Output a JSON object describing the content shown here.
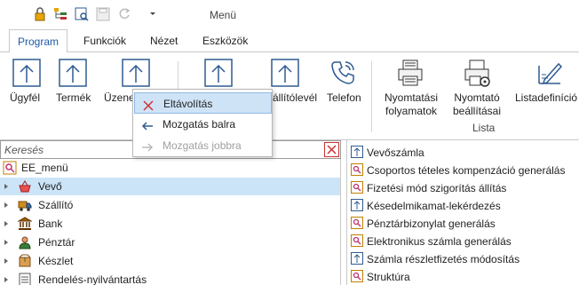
{
  "window": {
    "title": "Menü"
  },
  "quick_access": {
    "items": [
      "lock-icon",
      "tree-icon",
      "preview-icon",
      "save-icon",
      "refresh-icon",
      "dropdown-icon"
    ]
  },
  "tabs": [
    {
      "label": "Program",
      "active": true
    },
    {
      "label": "Funkciók",
      "active": false
    },
    {
      "label": "Nézet",
      "active": false
    },
    {
      "label": "Eszközök",
      "active": false
    }
  ],
  "ribbon": {
    "buttons": [
      {
        "label": "Ügyfél",
        "icon": "arrow-up-box-icon"
      },
      {
        "label": "Termék",
        "icon": "arrow-up-box-icon"
      },
      {
        "label": "Üzene",
        "icon": "arrow-up-box-icon"
      },
      {
        "label": "állítólevél",
        "icon": "arrow-up-box-icon"
      },
      {
        "label": "Telefon",
        "icon": "phone-icon"
      },
      {
        "label": "Nyomtatási\nfolyamatok",
        "icon": "printer-icon"
      },
      {
        "label": "Nyomtató\nbeállításai",
        "icon": "printer-settings-icon"
      },
      {
        "label": "Listadefiníció",
        "icon": "edit-list-icon"
      }
    ],
    "group_label": "Lista"
  },
  "context_menu": {
    "items": [
      {
        "label": "Eltávolítás",
        "icon": "x-icon",
        "highlighted": true,
        "disabled": false
      },
      {
        "label": "Mozgatás balra",
        "icon": "arrow-left-icon",
        "highlighted": false,
        "disabled": false
      },
      {
        "label": "Mozgatás jobbra",
        "icon": "arrow-right-icon",
        "highlighted": false,
        "disabled": true
      }
    ]
  },
  "search": {
    "placeholder": "Keresés"
  },
  "tree": {
    "root": "EE_menü",
    "items": [
      {
        "label": "Vevő",
        "selected": true,
        "icon": "basket-icon"
      },
      {
        "label": "Szállító",
        "selected": false,
        "icon": "truck-icon"
      },
      {
        "label": "Bank",
        "selected": false,
        "icon": "bank-icon"
      },
      {
        "label": "Pénztár",
        "selected": false,
        "icon": "cashier-icon"
      },
      {
        "label": "Készlet",
        "selected": false,
        "icon": "box-icon"
      },
      {
        "label": "Rendelés-nyilvántartás",
        "selected": false,
        "icon": "document-icon"
      }
    ]
  },
  "right_list": {
    "items": [
      {
        "label": "Vevőszámla",
        "icon": "arrow-up-box-icon"
      },
      {
        "label": "Csoportos tételes kompenzáció generálás",
        "icon": "magnifier-doc-icon"
      },
      {
        "label": "Fizetési mód szigorítás állítás",
        "icon": "magnifier-doc-icon"
      },
      {
        "label": "Késedelmikamat-lekérdezés",
        "icon": "arrow-up-box-icon"
      },
      {
        "label": "Pénztárbizonylat generálás",
        "icon": "magnifier-doc-icon"
      },
      {
        "label": "Elektronikus számla generálás",
        "icon": "magnifier-doc-icon"
      },
      {
        "label": "Számla részletfizetés módosítás",
        "icon": "arrow-up-box-icon"
      },
      {
        "label": "Struktúra",
        "icon": "magnifier-doc-icon"
      }
    ]
  },
  "colors": {
    "accent": "#1f5aa8",
    "selection": "#cce4f7",
    "menu_highlight": "#cfe3f7",
    "icon_blue": "#2f5b90"
  }
}
